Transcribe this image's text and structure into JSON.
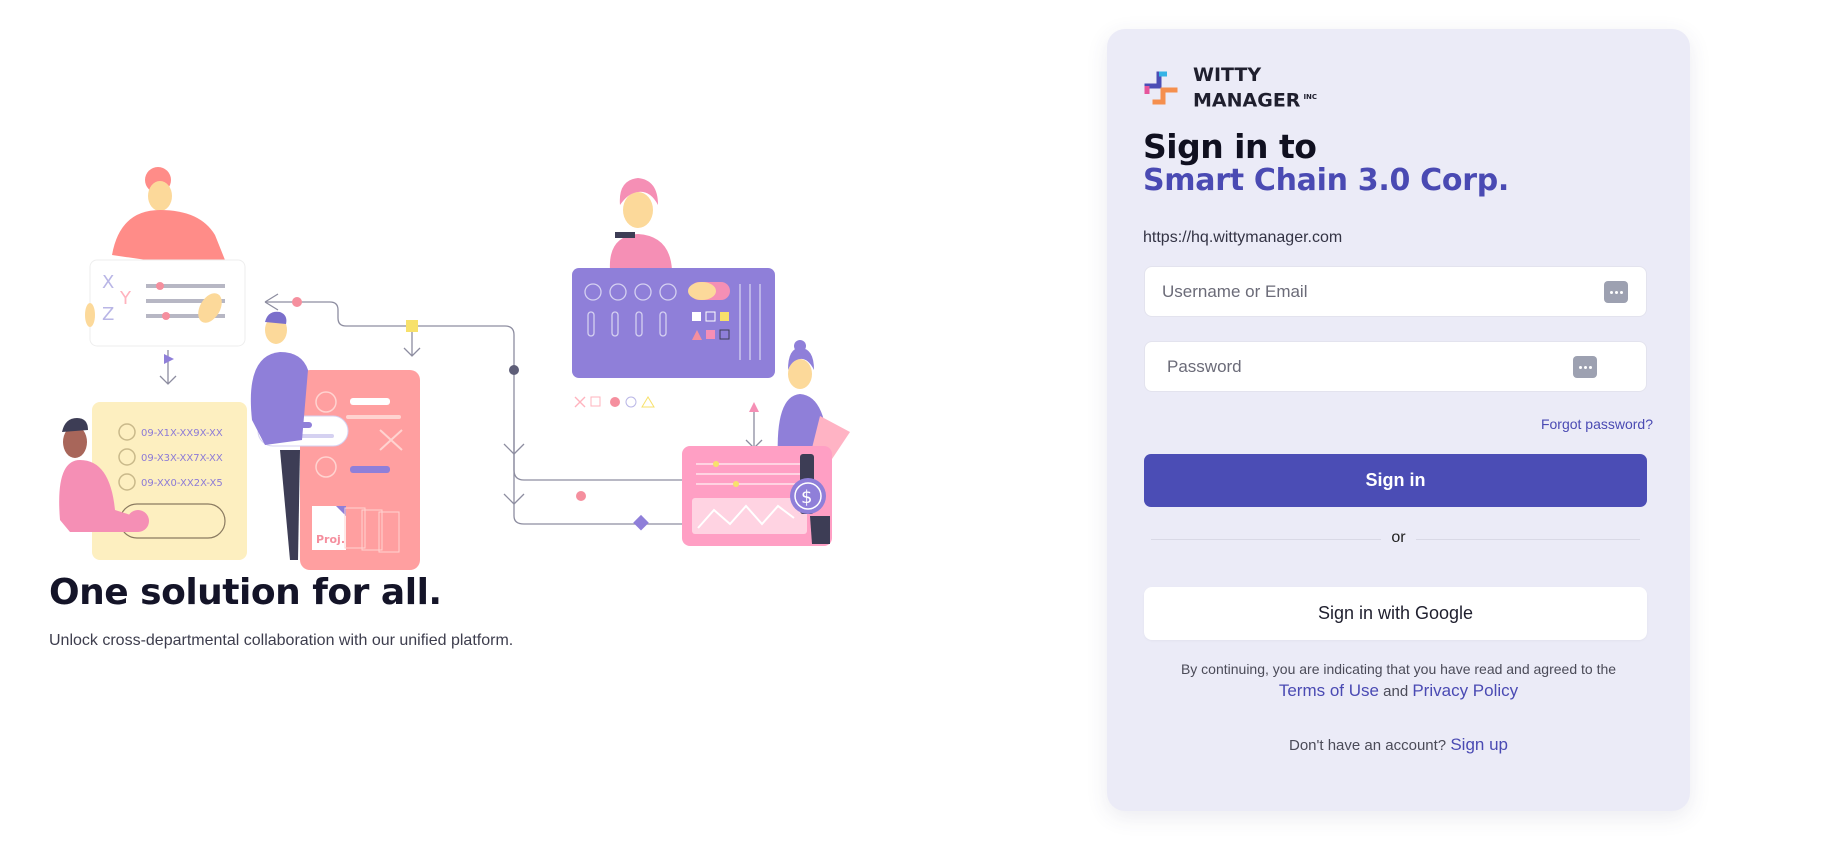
{
  "left": {
    "headline": "One solution for all.",
    "subtext": "Unlock cross-departmental collaboration with our unified platform.",
    "illustration": {
      "xyz_letters": [
        "X",
        "Y",
        "Z"
      ],
      "id_codes": [
        "09-X1X-XX9X-XX",
        "09-X3X-XX7X-XX",
        "09-XX0-XX2X-X5"
      ],
      "doc_label": "Proj.",
      "currency_symbol": "$"
    }
  },
  "card": {
    "brand": {
      "line1": "WITTY",
      "line2": "MANAGER",
      "suffix": "INC",
      "logo_icon": "witty-logo-icon"
    },
    "title_line1": "Sign in to",
    "title_line2": "Smart Chain 3.0 Corp.",
    "url": "https://hq.wittymanager.com",
    "username": {
      "placeholder": "Username or Email",
      "value": ""
    },
    "password": {
      "placeholder": "Password",
      "value": ""
    },
    "forgot_label": "Forgot password?",
    "signin_label": "Sign in",
    "or_label": "or",
    "google_label": "Sign in with Google",
    "legal_text": "By continuing, you are indicating that you have read and agreed to the",
    "terms_label": "Terms of Use",
    "and_label": "and",
    "privacy_label": "Privacy Policy",
    "no_account_text": "Don't have an account?",
    "signup_label": "Sign up"
  },
  "colors": {
    "accent": "#4b4db5",
    "card_bg": "#ebebf7",
    "illus_purple": "#8f7fd9",
    "illus_pink": "#ff9eb0",
    "illus_yellow": "#fdefc0"
  }
}
